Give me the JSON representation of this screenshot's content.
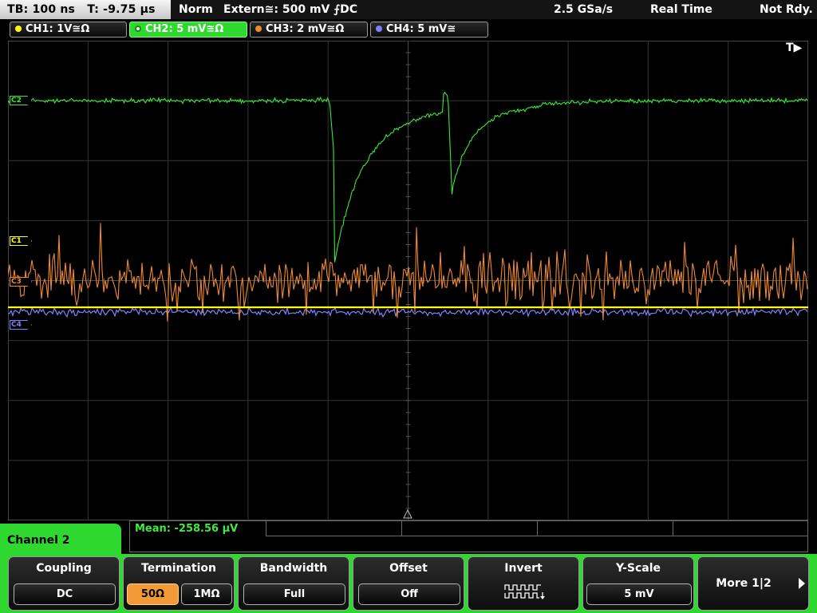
{
  "top_bar": {
    "timebase": "TB: 100 ns",
    "trigger_time": "T: -9.75 µs",
    "trigger_mode": "Norm",
    "trigger_source": "Extern≅: 500 mV ⨍DC",
    "sample_rate": "2.5 GSa/s",
    "acquisition": "Real Time",
    "status": "Not Rdy."
  },
  "channels": [
    {
      "label": "CH1: 1V≅Ω",
      "color": "#ffff00",
      "active": false,
      "marker": "C1"
    },
    {
      "label": "CH2: 5 mV≅Ω",
      "color": "#39e839",
      "active": true,
      "marker": "C2"
    },
    {
      "label": "CH3: 2 mV≅Ω",
      "color": "#f08a2a",
      "active": false,
      "marker": "C3"
    },
    {
      "label": "CH4: 5 mV≅",
      "color": "#8080ff",
      "active": false,
      "marker": "C4"
    }
  ],
  "display": {
    "trigger_indicator": "T▶",
    "grid_divisions": {
      "horizontal": 10,
      "vertical": 8
    }
  },
  "measurement": {
    "label": "Mean: -258.56 µV"
  },
  "menu": {
    "title": "Channel 2",
    "softkeys": {
      "coupling": {
        "title": "Coupling",
        "value": "DC"
      },
      "termination": {
        "title": "Termination",
        "option_50": "50Ω",
        "option_1m": "1MΩ",
        "selected": "50Ω"
      },
      "bandwidth": {
        "title": "Bandwidth",
        "value": "Full"
      },
      "offset": {
        "title": "Offset",
        "value": "Off"
      },
      "invert": {
        "title": "Invert",
        "icon": "square-wave-invert-icon"
      },
      "yscale": {
        "title": "Y-Scale",
        "value": "5 mV"
      },
      "more": {
        "title": "More 1|2"
      }
    }
  },
  "colors": {
    "accent_green": "#2fd82f",
    "selected_orange": "#f19a37",
    "grid": "#3a3a3a"
  }
}
